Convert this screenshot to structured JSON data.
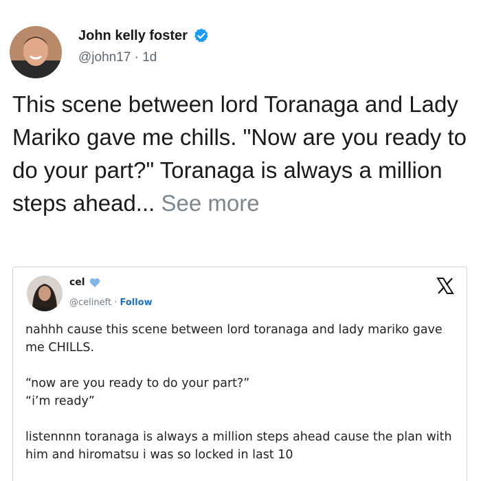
{
  "post": {
    "author_name": "John kelly foster",
    "handle": "@john17",
    "separator": "·",
    "time_ago": "1d",
    "verified_icon": "verified-badge-icon",
    "text": "This scene between lord Toranaga and Lady Mariko gave me chills. \"Now are you ready to do your part?\" Toranaga is always a million steps ahead...",
    "see_more_label": "See more"
  },
  "quoted": {
    "author_name": "cel",
    "heart_icon": "blue-heart-icon",
    "handle": "@celineft",
    "separator": "·",
    "follow_label": "Follow",
    "platform_icon": "x-logo-icon",
    "paragraphs": [
      "nahhh cause this scene between lord toranaga and lady mariko gave me CHILLS.",
      "“now are you ready to do your part?”\n“i’m ready”",
      "listennnn toranaga is always a million steps ahead cause the plan with him and hiromatsu i was so locked in last 10"
    ]
  },
  "colors": {
    "verified_blue": "#1d9bf0",
    "heart_blue": "#7fb6e6",
    "meta_gray": "#5b6670",
    "follow_blue": "#1d6fb8",
    "card_border": "#cfd6db"
  }
}
